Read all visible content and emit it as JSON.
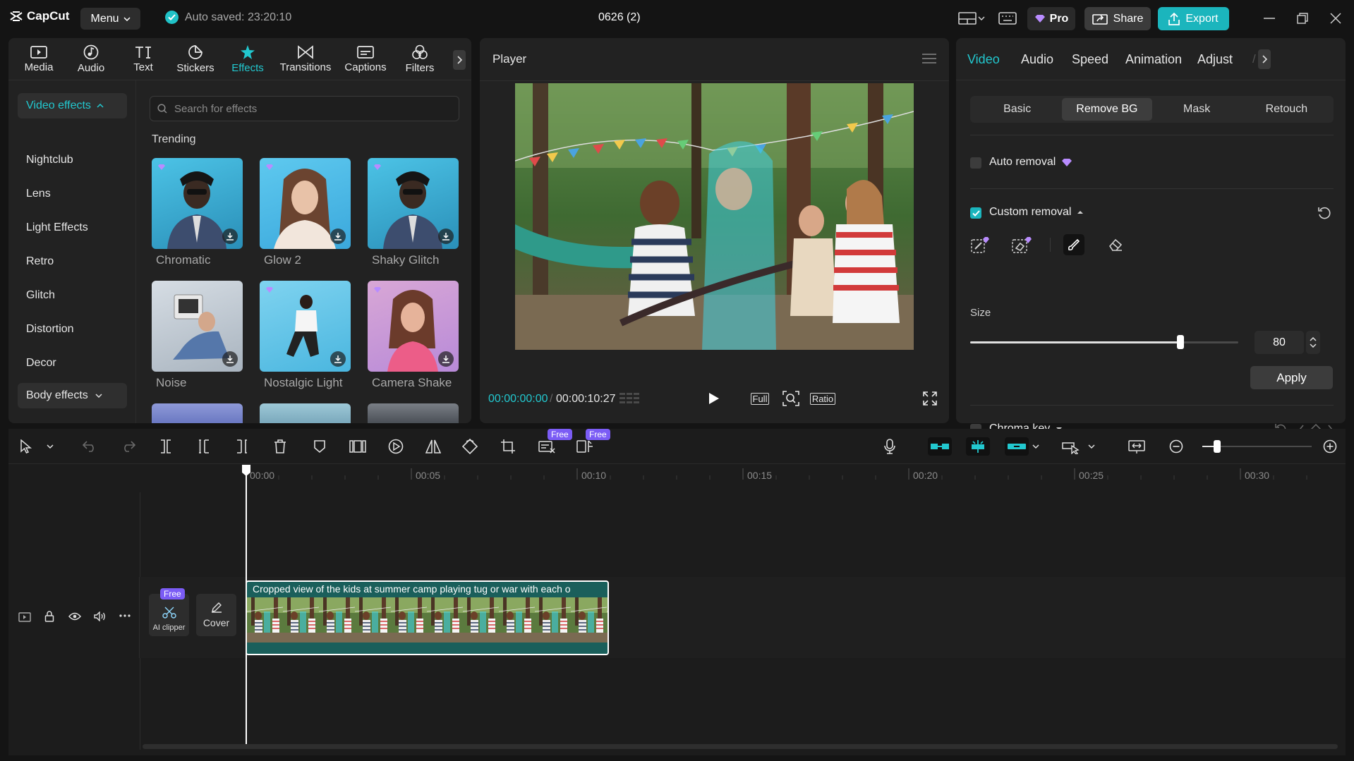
{
  "titlebar": {
    "app_name": "CapCut",
    "menu_label": "Menu",
    "autosave_text": "Auto saved: 23:20:10",
    "project_title": "0626 (2)",
    "pro_label": "Pro",
    "share_label": "Share",
    "export_label": "Export"
  },
  "left_tabs": [
    {
      "label": "Media",
      "icon": "media-icon"
    },
    {
      "label": "Audio",
      "icon": "audio-icon"
    },
    {
      "label": "Text",
      "icon": "text-icon"
    },
    {
      "label": "Stickers",
      "icon": "stickers-icon"
    },
    {
      "label": "Effects",
      "icon": "effects-icon",
      "active": true
    },
    {
      "label": "Transitions",
      "icon": "transitions-icon"
    },
    {
      "label": "Captions",
      "icon": "captions-icon"
    },
    {
      "label": "Filters",
      "icon": "filters-icon"
    }
  ],
  "categories": {
    "header": "Video effects",
    "items": [
      "Nightclub",
      "Lens",
      "Light Effects",
      "Retro",
      "Glitch",
      "Distortion",
      "Decor"
    ],
    "footer": "Body effects"
  },
  "search": {
    "placeholder": "Search for effects"
  },
  "trending_label": "Trending",
  "effects": [
    {
      "label": "Chromatic"
    },
    {
      "label": "Glow 2"
    },
    {
      "label": "Shaky Glitch"
    },
    {
      "label": "Noise"
    },
    {
      "label": "Nostalgic Light"
    },
    {
      "label": "Camera Shake"
    }
  ],
  "player": {
    "title": "Player",
    "current_time": "00:00:00:00",
    "total_time": "00:00:10:27",
    "full_label": "Full",
    "ratio_label": "Ratio"
  },
  "inspector": {
    "tabs": [
      "Video",
      "Audio",
      "Speed",
      "Animation",
      "Adjust"
    ],
    "subtabs": [
      "Basic",
      "Remove BG",
      "Mask",
      "Retouch"
    ],
    "active_subtab": "Remove BG",
    "auto_removal": "Auto removal",
    "custom_removal": "Custom removal",
    "size_label": "Size",
    "size_value": "80",
    "size_fraction": 0.78,
    "apply_label": "Apply",
    "chroma_key": "Chroma key"
  },
  "timeline": {
    "free_badge": "Free",
    "ticks": [
      "00:00",
      "00:05",
      "00:10",
      "00:15",
      "00:20",
      "00:25",
      "00:30"
    ],
    "clip_title": "Cropped view of the kids at summer camp playing tug or war with each o",
    "ai_clipper_label": "AI clipper",
    "cover_label": "Cover"
  },
  "colors": {
    "accent": "#22c8cf",
    "export": "#1bb5bd",
    "badge": "#7b5cf5",
    "panel": "#222222"
  }
}
